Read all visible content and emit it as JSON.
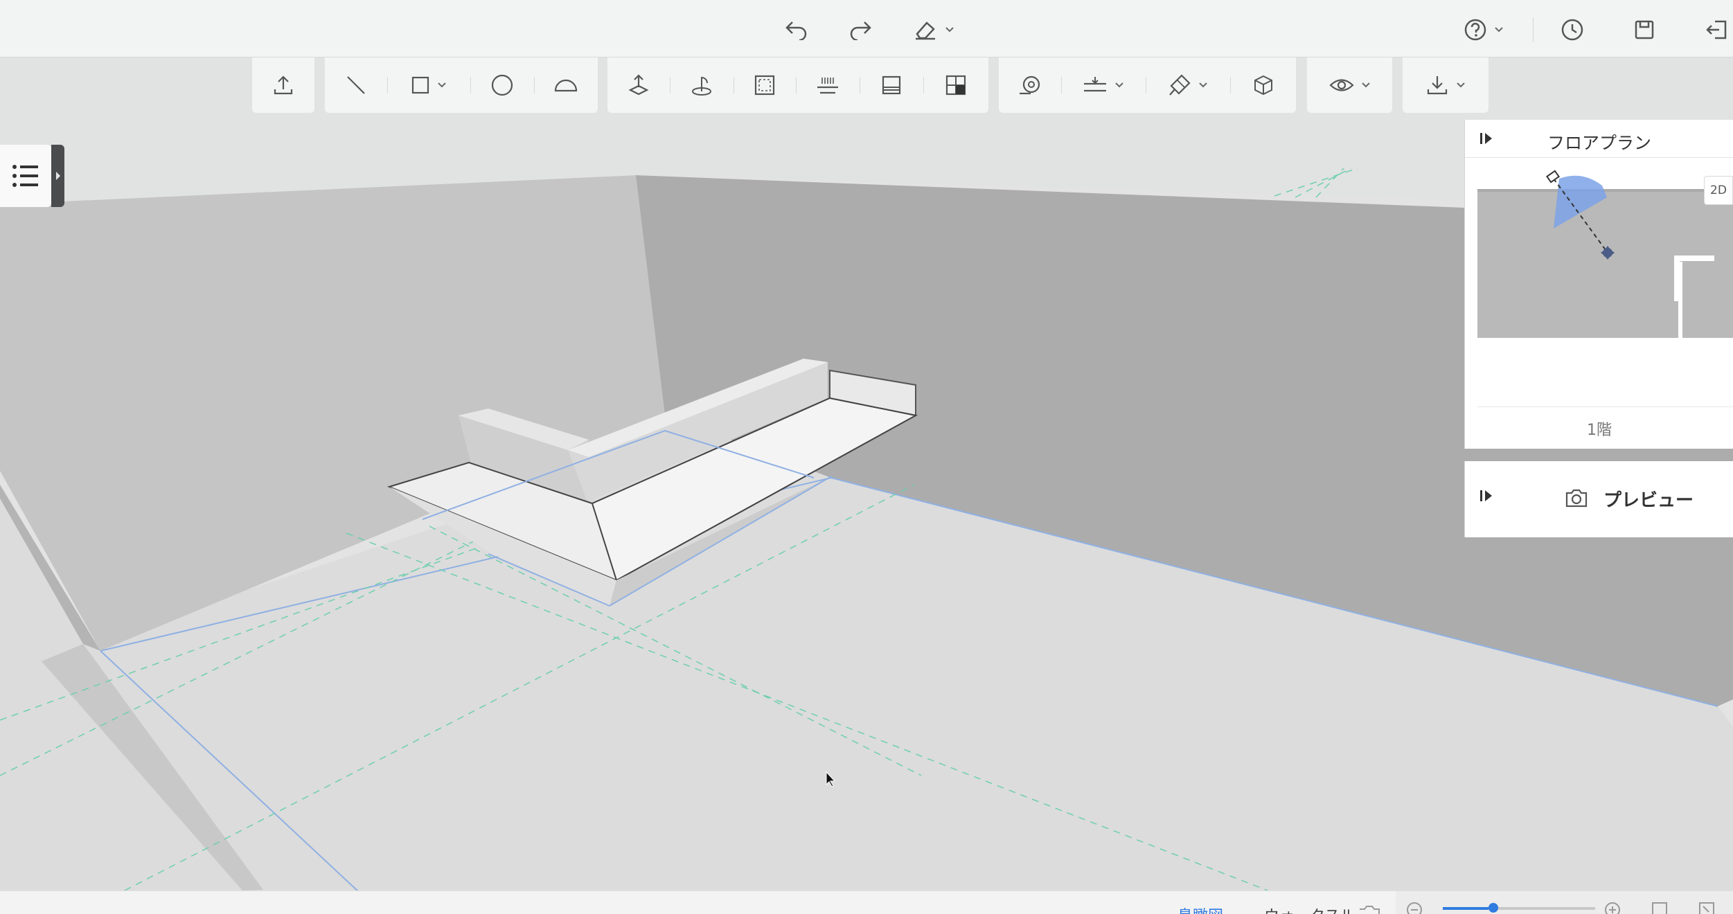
{
  "topbar": {
    "undo_icon": "undo-arrow-icon",
    "redo_icon": "redo-arrow-icon",
    "eraser_icon": "eraser-icon",
    "help_icon": "help-circle-icon",
    "history_icon": "clock-icon",
    "save_icon": "save-disk-icon",
    "exit_icon": "exit-icon"
  },
  "toolbar": {
    "group1": [
      "upload-icon"
    ],
    "group2": [
      "line-icon",
      "rectangle-icon",
      "circle-icon",
      "arc-icon"
    ],
    "group3": [
      "push-pull-icon",
      "rotate-icon",
      "select-area-icon",
      "level-icon",
      "split-icon",
      "material-icon"
    ],
    "group4": [
      "tape-measure-icon",
      "align-icon",
      "paint-icon",
      "box-3d-icon"
    ],
    "group5": [
      "eye-icon"
    ],
    "group6": [
      "download-icon"
    ]
  },
  "left_tab": {
    "menu_icon": "list-menu-icon",
    "handle_icon": "expand-right-icon"
  },
  "floorplan": {
    "title": "フロアプラン",
    "floor": "1階",
    "mode_button": "2D"
  },
  "preview": {
    "label": "プレビュー",
    "icon": "camera-icon"
  },
  "bottombar": {
    "tab1": "鳥瞰図",
    "tab2": "ウォークスル"
  },
  "colors": {
    "accent": "#2f7be0",
    "panel_bg": "#ffffff",
    "floor": "#dcdcdc",
    "wall_left": "#c4c4c4",
    "wall_right": "#ababab"
  }
}
